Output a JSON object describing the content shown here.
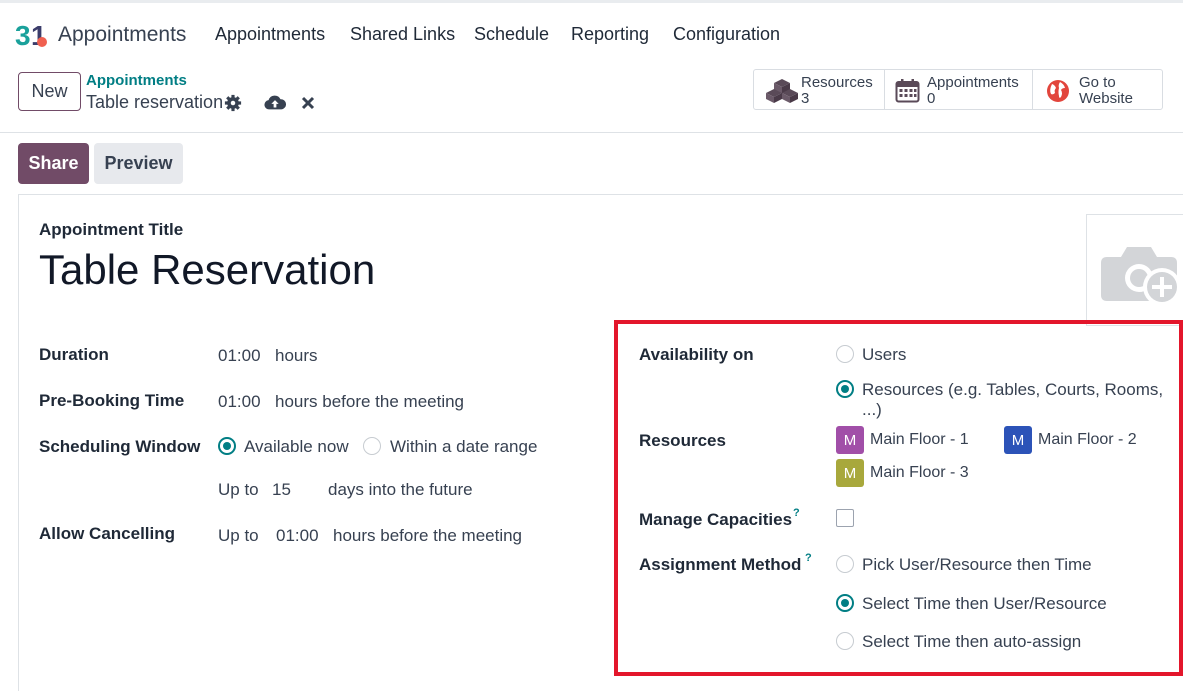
{
  "nav": {
    "app_name": "Appointments",
    "menu": [
      "Appointments",
      "Shared Links",
      "Schedule",
      "Reporting",
      "Configuration"
    ]
  },
  "control_panel": {
    "new_label": "New",
    "breadcrumb_parent": "Appointments",
    "breadcrumb_current": "Table reservation",
    "stat_buttons": [
      {
        "label": "Resources",
        "value": "3",
        "icon": "cubes-icon"
      },
      {
        "label": "Appointments",
        "value": "0",
        "icon": "calendar-icon"
      },
      {
        "label": "Go to",
        "value": "Website",
        "icon": "globe-icon"
      }
    ]
  },
  "status_bar": {
    "share_label": "Share",
    "preview_label": "Preview"
  },
  "form": {
    "title_label": "Appointment Title",
    "title_value": "Table Reservation",
    "duration": {
      "label": "Duration",
      "value": "01:00",
      "unit": "hours"
    },
    "pre_booking": {
      "label": "Pre-Booking Time",
      "value": "01:00",
      "unit": "hours before the meeting"
    },
    "scheduling_window": {
      "label": "Scheduling Window",
      "options": [
        "Available now",
        "Within a date range"
      ],
      "selected": "Available now",
      "upto_prefix": "Up to",
      "upto_value": "15",
      "upto_suffix": "days into the future"
    },
    "allow_cancelling": {
      "label": "Allow Cancelling",
      "prefix": "Up to",
      "value": "01:00",
      "suffix": "hours before the meeting"
    },
    "availability_on": {
      "label": "Availability on",
      "options": [
        "Users",
        "Resources (e.g. Tables, Courts, Rooms, ...)"
      ],
      "selected": "Resources (e.g. Tables, Courts, Rooms, ...)"
    },
    "resources": {
      "label": "Resources",
      "tags": [
        {
          "initial": "M",
          "name": "Main Floor - 1",
          "color": "#a14fa8"
        },
        {
          "initial": "M",
          "name": "Main Floor - 2",
          "color": "#2c53b8"
        },
        {
          "initial": "M",
          "name": "Main Floor - 3",
          "color": "#a8a83c"
        }
      ]
    },
    "manage_capacities": {
      "label": "Manage Capacities",
      "help": "?",
      "checked": false
    },
    "assignment_method": {
      "label": "Assignment Method",
      "help": "?",
      "options": [
        "Pick User/Resource then Time",
        "Select Time then User/Resource",
        "Select Time then auto-assign"
      ],
      "selected": "Select Time then User/Resource"
    }
  },
  "colors": {
    "primary": "#714b67",
    "accent": "#017e84",
    "highlight_box": "#e3162b"
  }
}
